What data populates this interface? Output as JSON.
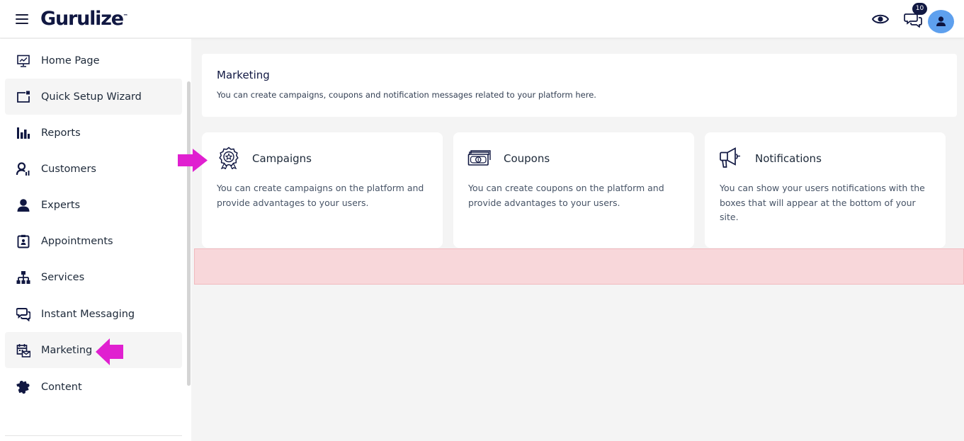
{
  "app": {
    "logo_text": "Gurulize",
    "logo_tm": "™"
  },
  "topbar": {
    "message_badge": "10",
    "icons": [
      "menu-icon",
      "eye-icon",
      "chat-icon",
      "user-avatar-icon"
    ]
  },
  "sidebar": {
    "items": [
      {
        "label": "Home Page",
        "icon": "presentation-chart-icon"
      },
      {
        "label": "Quick Setup Wizard",
        "icon": "wizard-window-icon"
      },
      {
        "label": "Reports",
        "icon": "bar-chart-icon"
      },
      {
        "label": "Customers",
        "icon": "customer-chart-icon"
      },
      {
        "label": "Experts",
        "icon": "user-icon"
      },
      {
        "label": "Appointments",
        "icon": "clipboard-user-icon"
      },
      {
        "label": "Services",
        "icon": "sitemap-icon"
      },
      {
        "label": "Instant Messaging",
        "icon": "chat-bubbles-icon"
      },
      {
        "label": "Marketing",
        "icon": "calendar-mail-icon"
      },
      {
        "label": "Content",
        "icon": "puzzle-icon"
      }
    ],
    "active": "Marketing"
  },
  "main": {
    "header": {
      "title": "Marketing",
      "description": "You can create campaigns, coupons and notification messages related to your platform here."
    },
    "cards": [
      {
        "title": "Campaigns",
        "icon": "award-badge-icon",
        "description": "You can create campaigns on the platform and provide advantages to your users."
      },
      {
        "title": "Coupons",
        "icon": "cash-icon",
        "description": "You can create coupons on the platform and provide advantages to your users."
      },
      {
        "title": "Notifications",
        "icon": "megaphone-icon",
        "description": "You can show your users notifications with the boxes that will appear at the bottom of your site."
      }
    ]
  },
  "colors": {
    "navy": "#111842",
    "avatar": "#5ea0ee",
    "annotation_arrow": "#e020d0",
    "alert_bg": "#f8d7da"
  }
}
